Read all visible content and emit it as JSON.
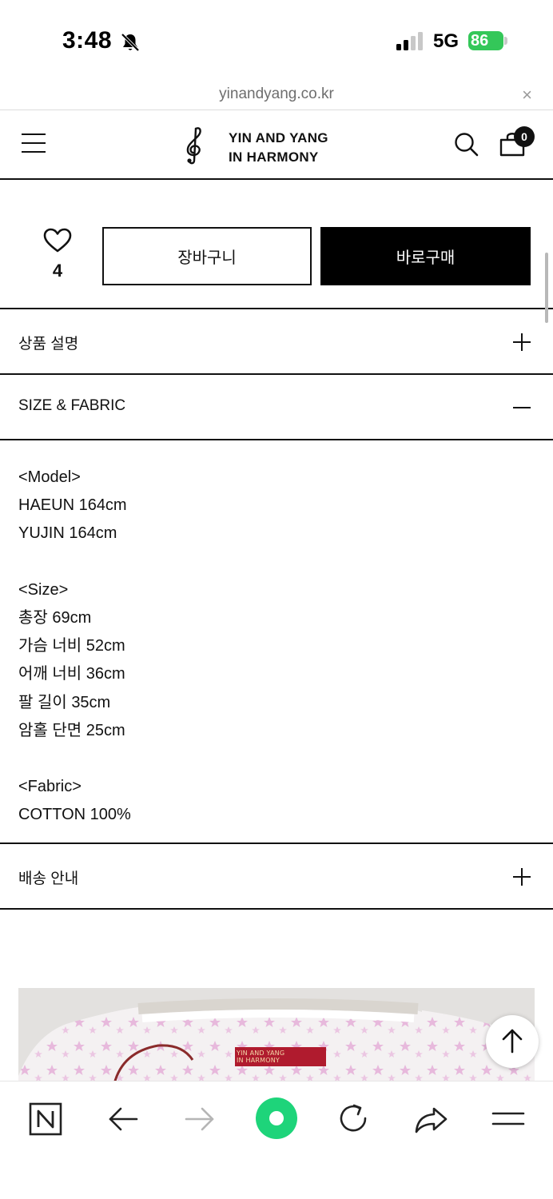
{
  "status_bar": {
    "time": "3:48",
    "network": "5G",
    "battery": "86"
  },
  "url_bar": {
    "url": "yinandyang.co.kr",
    "close": "×"
  },
  "header": {
    "brand_line1": "YIN AND YANG",
    "brand_line2": "IN HARMONY",
    "cart_count": "0"
  },
  "actions": {
    "like_count": "4",
    "cart_label": "장바구니",
    "buy_label": "바로구매"
  },
  "accordion": {
    "description_label": "상품 설명",
    "size_fabric_label": "SIZE & FABRIC",
    "shipping_label": "배송 안내"
  },
  "size_fabric": {
    "model_heading": "<Model>",
    "model_1": "HAEUN 164cm",
    "model_2": "YUJIN 164cm",
    "size_heading": "<Size>",
    "size_1": "총장 69cm",
    "size_2": "가슴 너비 52cm",
    "size_3": "어깨 너비 36cm",
    "size_4": "팔 길이 35cm",
    "size_5": "암홀 단면 25cm",
    "fabric_heading": "<Fabric>",
    "fabric_1": "COTTON 100%"
  },
  "product_image": {
    "label_line1": "YIN AND YANG",
    "label_line2": "IN HARMONY"
  },
  "colors": {
    "battery_green": "#34c759",
    "accent_green": "#1ed47a",
    "text_dark": "#111111",
    "label_red": "#b01b2e"
  },
  "icons": [
    "bell-slash-icon",
    "signal-icon",
    "close-icon",
    "hamburger-icon",
    "treble-clef-logo",
    "search-icon",
    "shopping-bag-icon",
    "heart-icon",
    "plus-icon",
    "minus-icon",
    "arrow-up-icon",
    "naver-n-icon",
    "back-arrow-icon",
    "forward-arrow-icon",
    "green-circle-icon",
    "reload-icon",
    "share-icon",
    "menu-icon"
  ]
}
